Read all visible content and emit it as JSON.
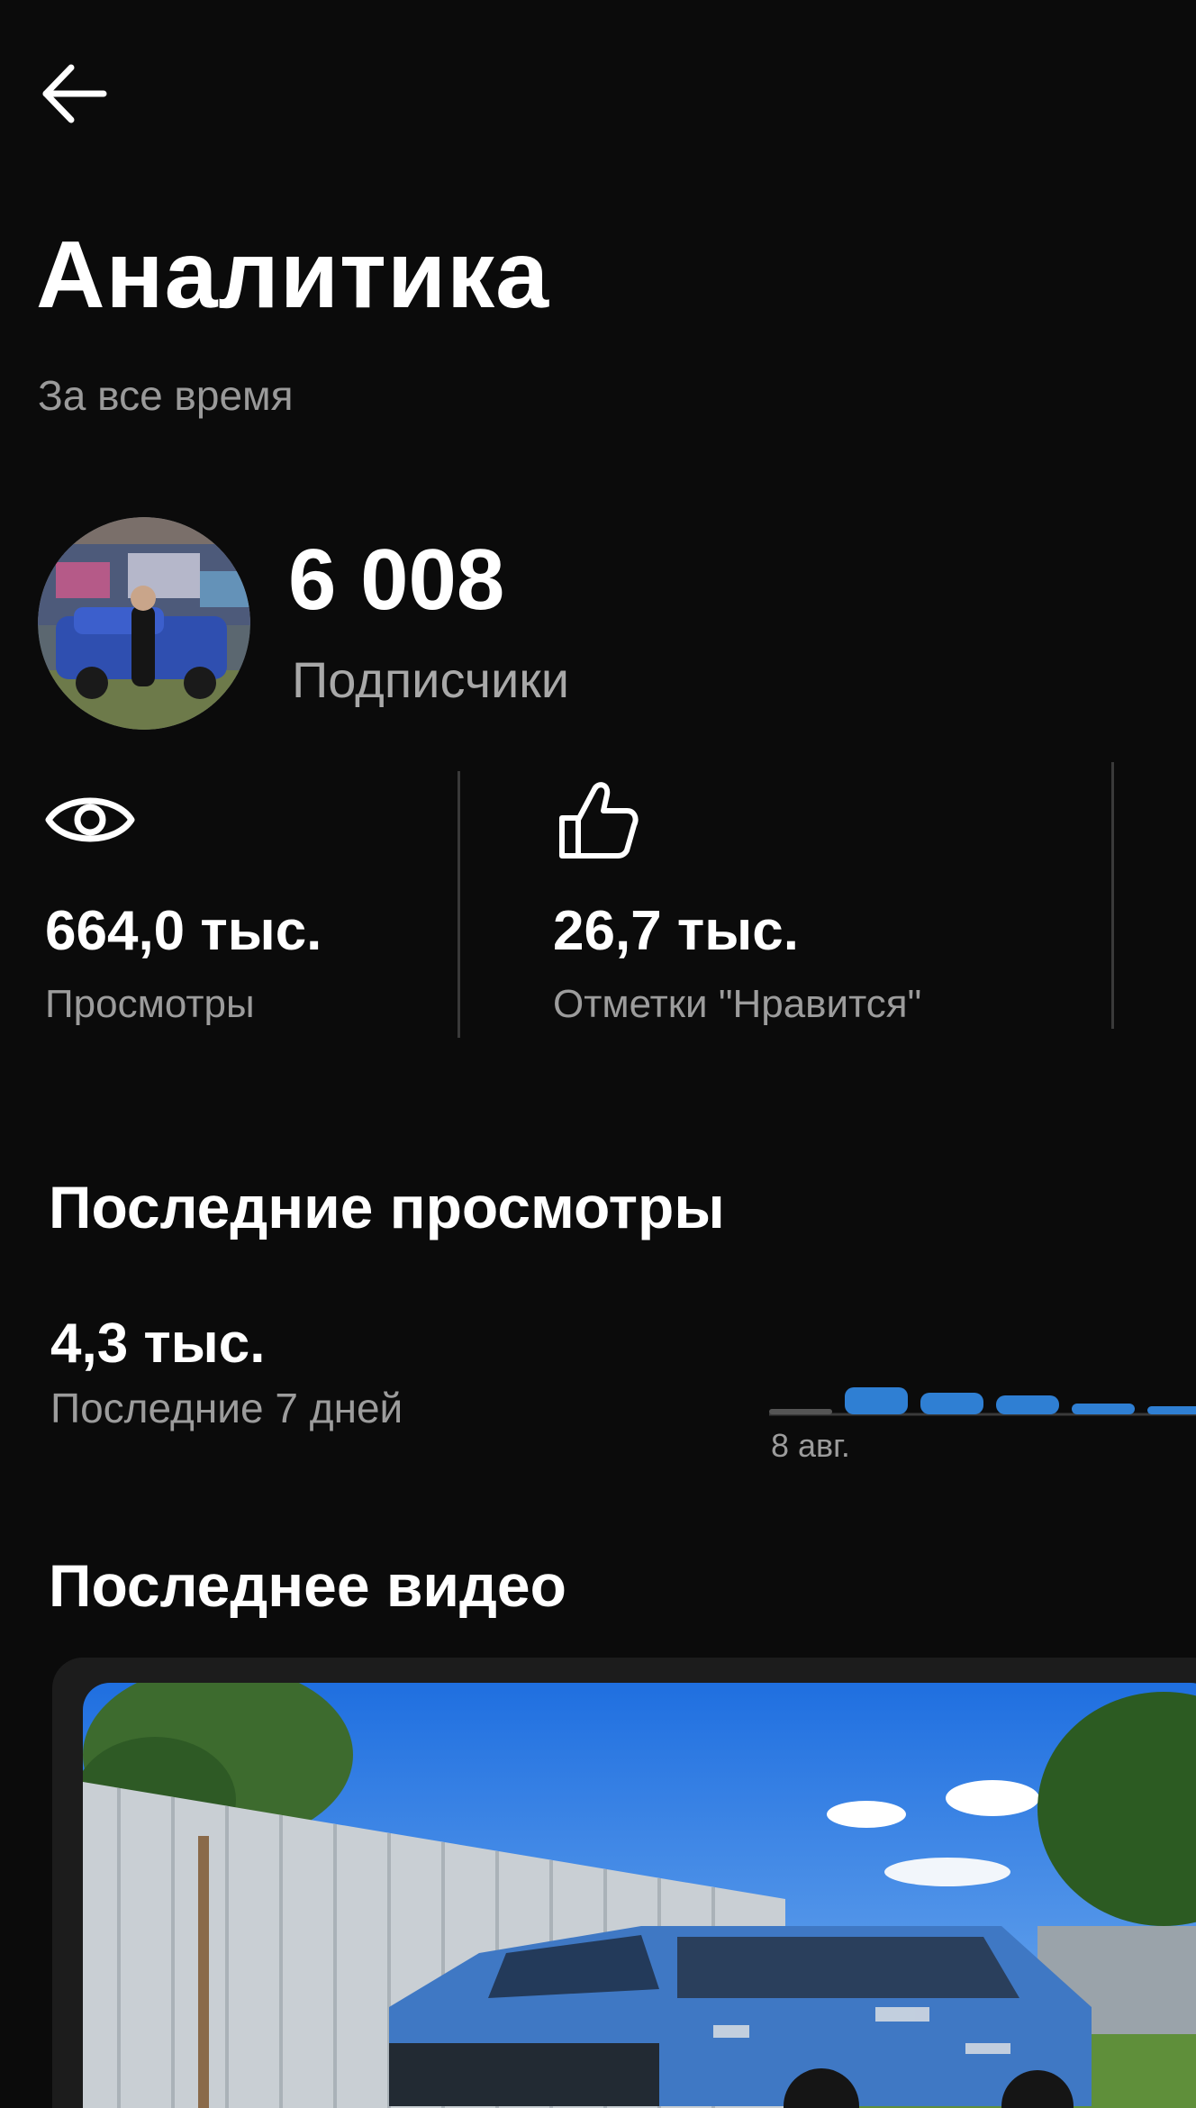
{
  "header": {
    "back_icon": "arrow-left-icon",
    "title": "Аналитика",
    "subtitle": "За все время"
  },
  "subscribers": {
    "count": "6 008",
    "label": "Подписчики"
  },
  "stats": [
    {
      "icon": "eye-icon",
      "value": "664,0 тыс.",
      "label": "Просмотры"
    },
    {
      "icon": "thumbs-up-icon",
      "value": "26,7 тыс.",
      "label": "Отметки \"Нравится\""
    }
  ],
  "recent_views": {
    "title": "Последние просмотры",
    "value": "4,3 тыс.",
    "period": "Последние 7 дней",
    "chart_start_label": "8 авг."
  },
  "chart_data": {
    "type": "bar",
    "categories": [
      "8 авг.",
      "",
      "",
      "",
      "",
      ""
    ],
    "values": [
      1,
      5,
      4,
      3.5,
      2,
      1.5
    ],
    "colors": [
      "#555555",
      "#2f7fd3",
      "#2f7fd3",
      "#2f7fd3",
      "#2f7fd3",
      "#2f7fd3"
    ],
    "title": "",
    "xlabel": "",
    "ylabel": ""
  },
  "latest_video": {
    "title": "Последнее видео"
  },
  "colors": {
    "background": "#0b0b0b",
    "text_primary": "#ffffff",
    "text_secondary": "#9c9c9c",
    "accent_bar": "#2f7fd3",
    "card": "#1c1c1c"
  }
}
